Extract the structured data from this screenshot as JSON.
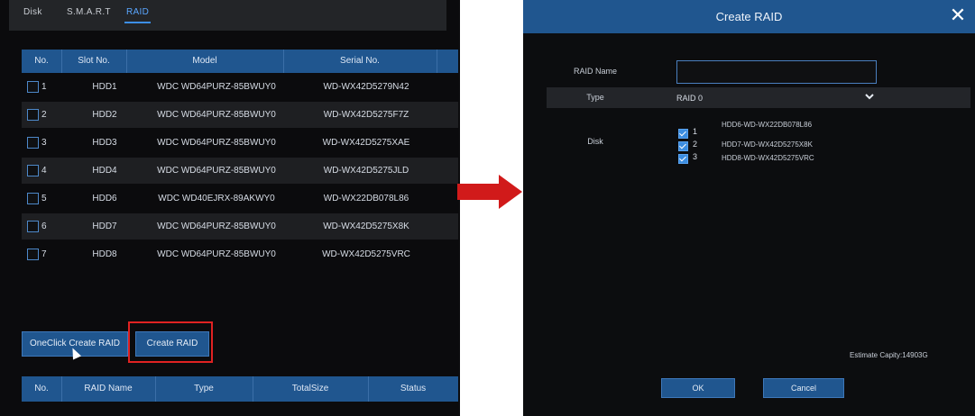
{
  "left": {
    "tabs": [
      "Disk",
      "S.M.A.R.T",
      "RAID"
    ],
    "table": {
      "headers": [
        "No.",
        "Slot No.",
        "Model",
        "Serial No."
      ],
      "rows": [
        {
          "no": "1",
          "slot": "HDD1",
          "model": "WDC WD64PURZ-85BWUY0",
          "serial": "WD-WX42D5279N42"
        },
        {
          "no": "2",
          "slot": "HDD2",
          "model": "WDC WD64PURZ-85BWUY0",
          "serial": "WD-WX42D5275F7Z"
        },
        {
          "no": "3",
          "slot": "HDD3",
          "model": "WDC WD64PURZ-85BWUY0",
          "serial": "WD-WX42D5275XAE"
        },
        {
          "no": "4",
          "slot": "HDD4",
          "model": "WDC WD64PURZ-85BWUY0",
          "serial": "WD-WX42D5275JLD"
        },
        {
          "no": "5",
          "slot": "HDD6",
          "model": "WDC WD40EJRX-89AKWY0",
          "serial": "WD-WX22DB078L86"
        },
        {
          "no": "6",
          "slot": "HDD7",
          "model": "WDC WD64PURZ-85BWUY0",
          "serial": "WD-WX42D5275X8K"
        },
        {
          "no": "7",
          "slot": "HDD8",
          "model": "WDC WD64PURZ-85BWUY0",
          "serial": "WD-WX42D5275VRC"
        }
      ]
    },
    "buttons": {
      "oneclick": "OneClick Create RAID",
      "create": "Create RAID"
    },
    "raid_table_headers": [
      "No.",
      "RAID Name",
      "Type",
      "TotalSize",
      "Status"
    ]
  },
  "dialog": {
    "title": "Create RAID",
    "close": "✕",
    "raid_name_label": "RAID Name",
    "raid_name_value": "",
    "type_label": "Type",
    "type_value": "RAID 0",
    "disk_label": "Disk",
    "disks": [
      {
        "num": "1",
        "label": "HDD6-WD-WX22DB078L86"
      },
      {
        "num": "2",
        "label": "HDD7-WD-WX42D5275X8K"
      },
      {
        "num": "3",
        "label": "HDD8-WD-WX42D5275VRC"
      }
    ],
    "capacity": "Estimate Capity:14903G",
    "ok": "OK",
    "cancel": "Cancel"
  }
}
